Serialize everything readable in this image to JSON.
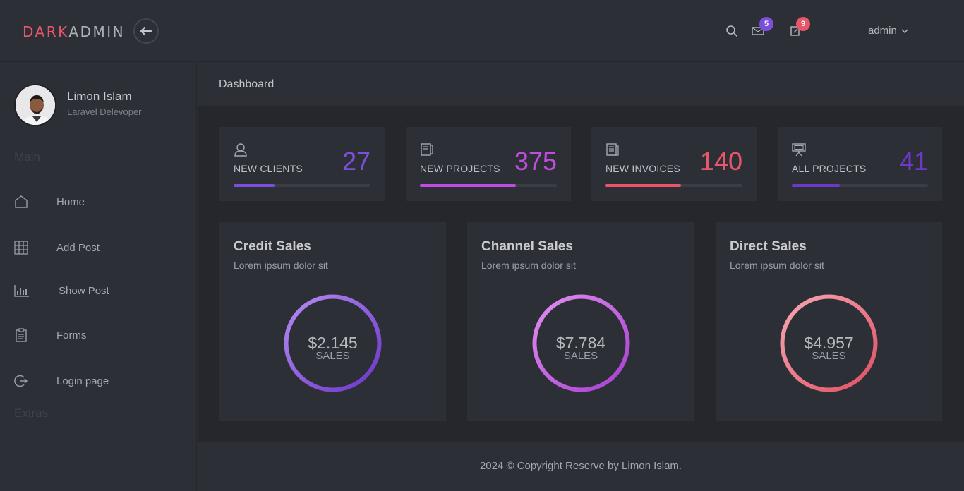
{
  "brand": {
    "part1": "DARK",
    "part2": "ADMIN",
    "accent": "#e9566a"
  },
  "topbar": {
    "back_icon": "arrow-left-icon",
    "search_icon": "search-icon",
    "mail_badge": "5",
    "notes_badge": "9",
    "user_label": "admin"
  },
  "profile": {
    "name": "Limon Islam",
    "role": "Laravel Delevoper"
  },
  "sidebar": {
    "section_main": "Main",
    "section_extras": "Extras",
    "items": [
      {
        "label": "Home",
        "icon": "home-icon"
      },
      {
        "label": "Add Post",
        "icon": "grid-icon"
      },
      {
        "label": "Show Post",
        "icon": "bar-chart-icon"
      },
      {
        "label": "Forms",
        "icon": "clipboard-icon"
      },
      {
        "label": "Login page",
        "icon": "logout-icon"
      }
    ]
  },
  "page": {
    "title": "Dashboard"
  },
  "stats": [
    {
      "label": "NEW CLIENTS",
      "value": "27",
      "color": "#7b4fd9",
      "progress": 30,
      "icon": "user-icon"
    },
    {
      "label": "NEW PROJECTS",
      "value": "375",
      "color": "#c04ddf",
      "progress": 70,
      "icon": "notebook-icon"
    },
    {
      "label": "NEW INVOICES",
      "value": "140",
      "color": "#e9566a",
      "progress": 55,
      "icon": "invoice-icon"
    },
    {
      "label": "ALL PROJECTS",
      "value": "41",
      "color": "#6e38c9",
      "progress": 35,
      "icon": "presentation-icon"
    }
  ],
  "sales": [
    {
      "title": "Credit Sales",
      "subtitle": "Lorem ipsum dolor sit",
      "value": "$2.145",
      "label": "SALES",
      "c1": "#b58cf0",
      "c2": "#6a35c9"
    },
    {
      "title": "Channel Sales",
      "subtitle": "Lorem ipsum dolor sit",
      "value": "$7.784",
      "label": "SALES",
      "c1": "#e28ef0",
      "c2": "#a63ed0"
    },
    {
      "title": "Direct Sales",
      "subtitle": "Lorem ipsum dolor sit",
      "value": "$4.957",
      "label": "SALES",
      "c1": "#f7a8b4",
      "c2": "#e04e62"
    }
  ],
  "footer": {
    "text": "2024 © Copyright Reserve by Limon Islam."
  }
}
